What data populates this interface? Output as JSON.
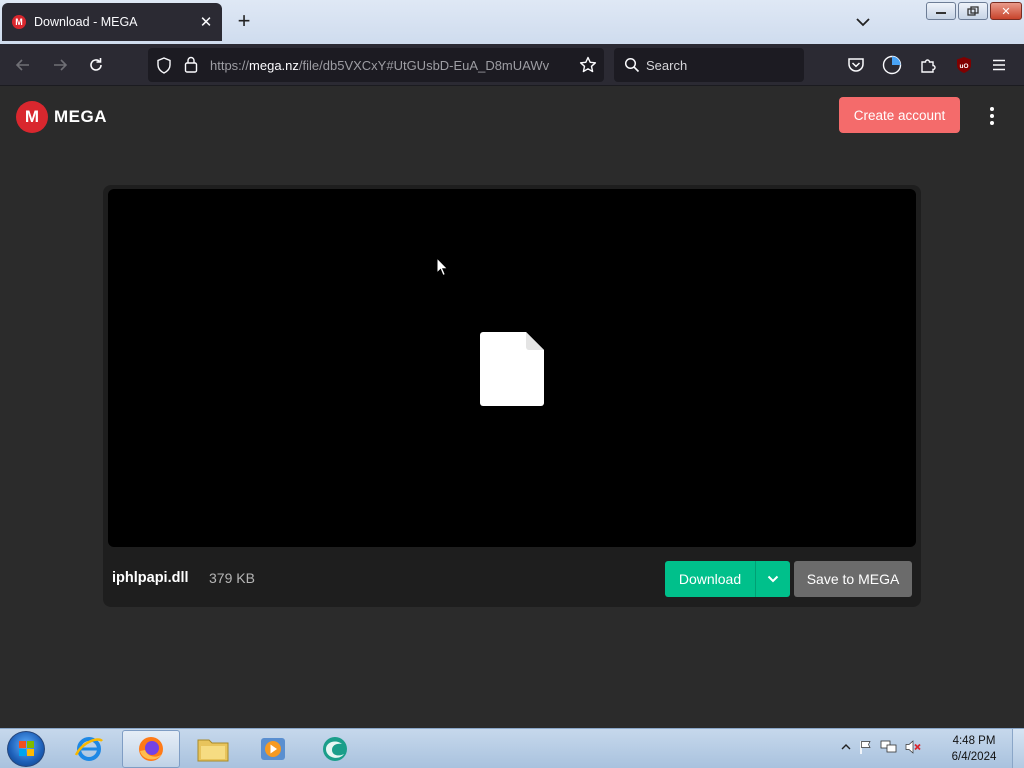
{
  "browser": {
    "tab": {
      "title": "Download - MEGA",
      "favicon": "mega-favicon"
    },
    "url": {
      "prefix": "https://",
      "host": "mega.nz",
      "path": "/file/db5VXCxY#UtGUsbD-EuA_D8mUAWv"
    },
    "search": {
      "placeholder": "Search"
    }
  },
  "mega": {
    "logo_text": "MEGA",
    "logo_letter": "M",
    "create_account_label": "Create account",
    "file": {
      "name": "iphlpapi.dll",
      "size": "379 KB"
    },
    "download_label": "Download",
    "save_label": "Save to MEGA",
    "colors": {
      "brand": "#d9272e",
      "download": "#00c08b",
      "create": "#f46b6b"
    }
  },
  "taskbar": {
    "time": "4:48 PM",
    "date": "6/4/2024",
    "apps": [
      "internet-explorer",
      "firefox",
      "file-explorer",
      "media-player",
      "browser-app"
    ]
  }
}
